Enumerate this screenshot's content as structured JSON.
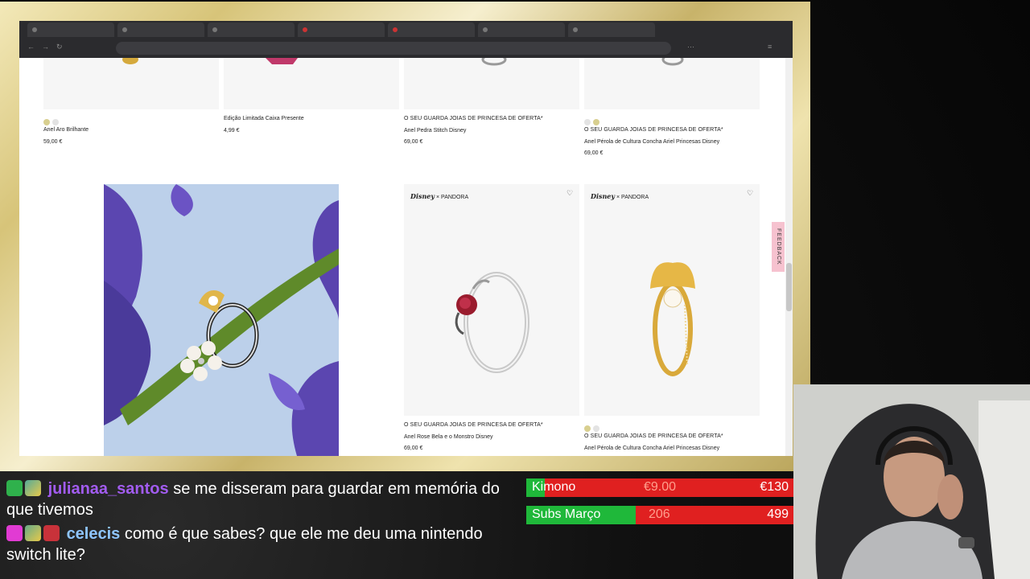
{
  "browser": {
    "tabs": [
      "",
      "",
      "",
      "",
      "",
      "",
      "",
      ""
    ],
    "products_top": [
      {
        "swatches": [
          "#d8cf8f",
          "#e3e3e3"
        ],
        "tag": "",
        "name": "Anel Aro Brilhante",
        "price": "59,00 €"
      },
      {
        "swatches": [],
        "tag": "",
        "name": "Edição Limitada Caixa Presente",
        "price": "4,99 €"
      },
      {
        "swatches": [],
        "tag": "O SEU GUARDA JOIAS DE PRINCESA DE OFERTA*",
        "name": "Anel Pedra Stitch Disney",
        "price": "69,00 €"
      },
      {
        "swatches": [
          "#e3e3e3",
          "#d8cf8f"
        ],
        "tag": "O SEU GUARDA JOIAS DE PRINCESA DE OFERTA*",
        "name": "Anel Pérola de Cultura Concha Ariel Princesas Disney",
        "price": "69,00 €"
      }
    ],
    "products_bottom": [
      {
        "brand": "Disney",
        "x": "×",
        "brand2": "PANDORA",
        "swatches": [],
        "tag": "O SEU GUARDA JOIAS DE PRINCESA DE OFERTA*",
        "name": "Anel Rose Bela e o Monstro Disney",
        "price": "69,00 €"
      },
      {
        "brand": "Disney",
        "x": "×",
        "brand2": "PANDORA",
        "swatches": [
          "#d8cf8f",
          "#e3e3e3"
        ],
        "tag": "O SEU GUARDA JOIAS DE PRINCESA DE OFERTA*",
        "name": "Anel Pérola de Cultura Concha Ariel Princesas Disney",
        "price": ""
      }
    ],
    "feedback": "FEEDBACK"
  },
  "chat": [
    {
      "user": "julianaa_santos",
      "text": "se me disseram para guardar em memória do que tivemos"
    },
    {
      "user": "celecis",
      "text": "como é que sabes? que ele me deu uma nintendo switch lite?"
    }
  ],
  "goals": [
    {
      "label": "Kimono",
      "current": "€9.00",
      "target": "€130",
      "progress": 0.07
    },
    {
      "label": "Subs Março",
      "current": "206",
      "target": "499",
      "progress": 0.41
    }
  ],
  "colors": {
    "goal_fill": "#1fb83a",
    "goal_bg": "#e02020",
    "frame": "#d7c479",
    "feedback": "#f6c2cf"
  }
}
